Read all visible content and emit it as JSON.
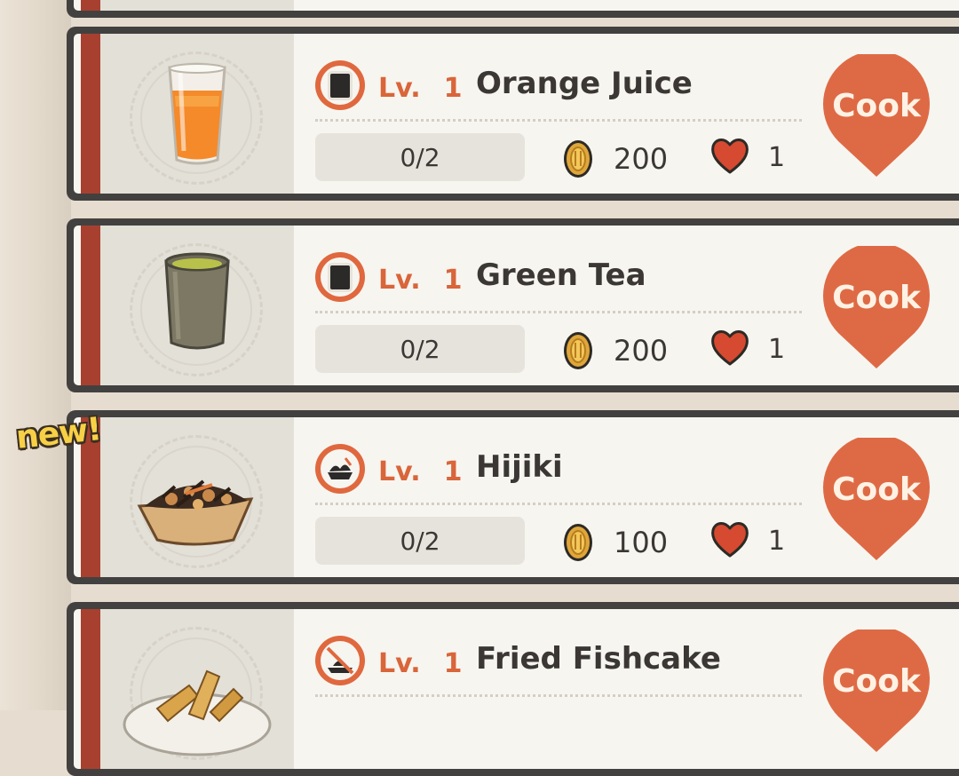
{
  "colors": {
    "card_border": "#424140",
    "card_bg": "#f7f5f0",
    "accent_red": "#a84030",
    "cook_orange": "#de6a45",
    "level_orange": "#d9653a",
    "heart_red": "#d54a30",
    "coin_gold": "#d69a2a",
    "new_yellow": "#f7d046"
  },
  "recipes": [
    {
      "name": "Orange Juice",
      "level_label": "Lv.",
      "level": "1",
      "type_icon": "drink-icon",
      "food_icon": "orange-juice-icon",
      "progress": "0/2",
      "coin_cost": "200",
      "hearts": "1",
      "action": "Cook",
      "is_new": false
    },
    {
      "name": "Green Tea",
      "level_label": "Lv.",
      "level": "1",
      "type_icon": "drink-icon",
      "food_icon": "green-tea-icon",
      "progress": "0/2",
      "coin_cost": "200",
      "hearts": "1",
      "action": "Cook",
      "is_new": false
    },
    {
      "name": "Hijiki",
      "level_label": "Lv.",
      "level": "1",
      "type_icon": "side-dish-icon",
      "food_icon": "hijiki-icon",
      "progress": "0/2",
      "coin_cost": "100",
      "hearts": "1",
      "action": "Cook",
      "is_new": true,
      "new_badge": "new!"
    },
    {
      "name": "Fried Fishcake",
      "level_label": "Lv.",
      "level": "1",
      "type_icon": "fried-dish-icon",
      "food_icon": "fried-fishcake-icon",
      "action": "Cook",
      "is_new": false
    }
  ]
}
